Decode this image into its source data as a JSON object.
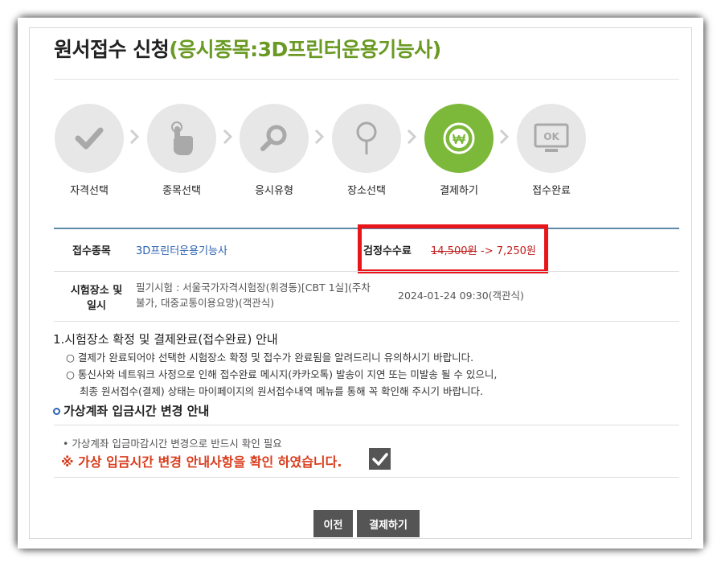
{
  "title": {
    "main": "원서접수 신청",
    "subject": "(응시종목:3D프린터운용기능사)"
  },
  "steps": [
    {
      "label": "자격선택",
      "icon": "check-icon"
    },
    {
      "label": "종목선택",
      "icon": "hand-pointer-icon"
    },
    {
      "label": "응시유형",
      "icon": "magnifier-icon"
    },
    {
      "label": "장소선택",
      "icon": "map-pin-icon"
    },
    {
      "label": "결제하기",
      "icon": "won-coin-icon",
      "active": true
    },
    {
      "label": "접수완료",
      "icon": "ok-monitor-icon"
    }
  ],
  "info": {
    "subject_label": "접수종목",
    "subject_value": "3D프린터운용기능사",
    "fee_label": "검정수수료",
    "fee_old": "14,500원",
    "fee_new": "-> 7,250원",
    "place_label_1": "시험장소 및",
    "place_label_2": "일시",
    "place_value_1": "필기시험 : 서울국가자격시험장(휘경동)[CBT 1실](주차",
    "place_value_2": "불가, 대중교통이용요망)(객관식)",
    "datetime": "2024-01-24 09:30(객관식)"
  },
  "notice": {
    "title": "1.시험장소 확정 및 결제완료(접수완료) 안내",
    "line1": "○ 결제가 완료되어야 선택한 시험장소 확정 및 접수가 완료됨을 알려드리니 유의하시기 바랍니다.",
    "line2": "○ 통신사와 네트워크 사정으로 인해 접수완료 메시지(카카오톡) 발송이 지연 또는 미발송 될 수 있으니,",
    "line3": "최종 원서접수(결제) 상태는 마이페이지의 원서접수내역 메뉴를 통해 꼭 확인해 주시기 바랍니다."
  },
  "virtual_account": {
    "title": "가상계좌 입금시간 변경 안내",
    "bullet": "• 가상계좌 입금마감시간 변경으로 반드시 확인 필요",
    "confirm": "※ 가상 입금시간 변경 안내사항을 확인 하였습니다.",
    "checked": true
  },
  "buttons": {
    "prev": "이전",
    "pay": "결제하기"
  },
  "colors": {
    "accent_green": "#7cb83a",
    "subject_green": "#6a9a23",
    "highlight_red": "#e8161a",
    "fee_red": "#c2201f",
    "notice_red": "#d93c1c",
    "button_gray": "#555555"
  }
}
